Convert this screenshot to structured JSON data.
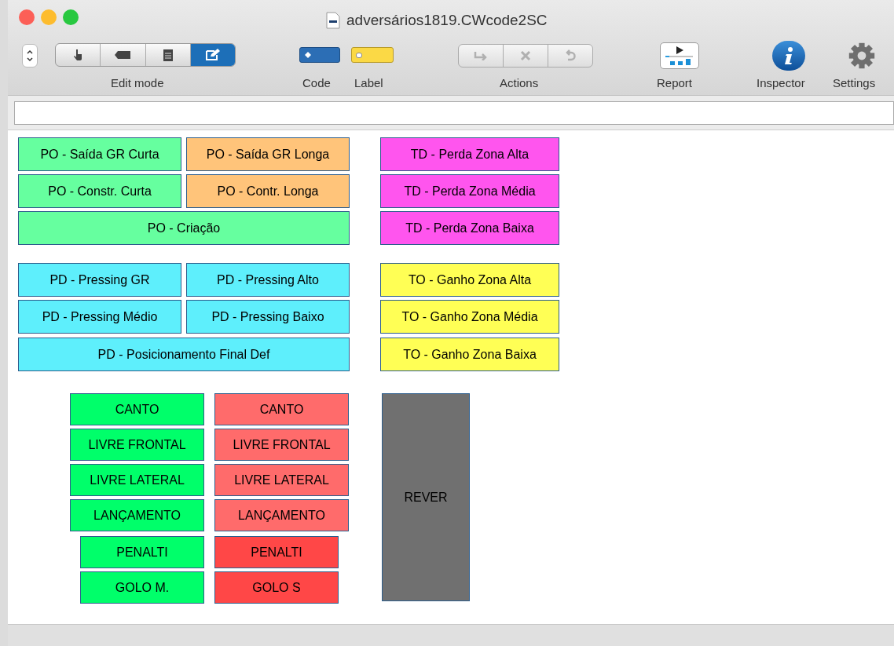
{
  "window": {
    "title": "adversários1819.CWcode2SC"
  },
  "toolbar": {
    "edit_mode": {
      "label": "Edit mode",
      "segments": [
        {
          "kind": "hand",
          "selected": false
        },
        {
          "kind": "tag",
          "selected": false
        },
        {
          "kind": "document",
          "selected": false
        },
        {
          "kind": "edit",
          "selected": true
        }
      ]
    },
    "code": {
      "label": "Code"
    },
    "label_item": {
      "label": "Label"
    },
    "actions": {
      "label": "Actions",
      "disabled": true
    },
    "report": {
      "label": "Report"
    },
    "inspector": {
      "label": "Inspector"
    },
    "settings": {
      "label": "Settings"
    }
  },
  "canvas_buttons": [
    {
      "label": "PO - Saída GR Curta",
      "color": "#66ff9f"
    },
    {
      "label": "PO - Saída GR Longa",
      "color": "#ffc47a"
    },
    {
      "label": "TD - Perda Zona Alta",
      "color": "#ff55ee"
    },
    {
      "label": "PO - Constr. Curta",
      "color": "#66ff9f"
    },
    {
      "label": "PO - Contr. Longa",
      "color": "#ffc47a"
    },
    {
      "label": "TD - Perda Zona Média",
      "color": "#ff55ee"
    },
    {
      "label": "PO - Criação",
      "color": "#66ff9f"
    },
    {
      "label": "TD - Perda Zona Baixa",
      "color": "#ff55ee"
    },
    {
      "label": "PD - Pressing GR",
      "color": "#5eeffc"
    },
    {
      "label": "PD - Pressing Alto",
      "color": "#5eeffc"
    },
    {
      "label": "TO - Ganho Zona Alta",
      "color": "#ffff55"
    },
    {
      "label": "PD - Pressing Médio",
      "color": "#5eeffc"
    },
    {
      "label": "PD - Pressing Baixo",
      "color": "#5eeffc"
    },
    {
      "label": "TO - Ganho Zona Média",
      "color": "#ffff55"
    },
    {
      "label": "PD - Posicionamento Final Def",
      "color": "#5eeffc"
    },
    {
      "label": "TO - Ganho Zona Baixa",
      "color": "#ffff55"
    },
    {
      "label": "CANTO",
      "color": "#00ff6a"
    },
    {
      "label": "CANTO",
      "color": "#ff6b6b"
    },
    {
      "label": "REVER",
      "color": "#707070"
    },
    {
      "label": "LIVRE FRONTAL",
      "color": "#00ff6a"
    },
    {
      "label": "LIVRE FRONTAL",
      "color": "#ff6b6b"
    },
    {
      "label": "LIVRE LATERAL",
      "color": "#00ff6a"
    },
    {
      "label": "LIVRE LATERAL",
      "color": "#ff6b6b"
    },
    {
      "label": "LANÇAMENTO",
      "color": "#00ff6a"
    },
    {
      "label": "LANÇAMENTO",
      "color": "#ff6b6b"
    },
    {
      "label": "PENALTI",
      "color": "#00ff6a"
    },
    {
      "label": "PENALTI",
      "color": "#ff4747"
    },
    {
      "label": "GOLO M.",
      "color": "#00ff6a"
    },
    {
      "label": "GOLO S",
      "color": "#ff4747"
    }
  ]
}
